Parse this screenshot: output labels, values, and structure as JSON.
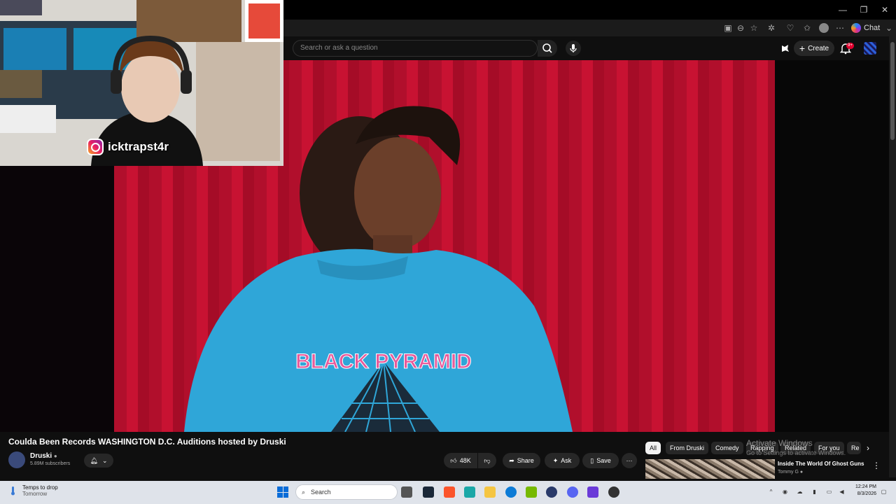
{
  "browser": {
    "window_buttons": [
      "—",
      "❐",
      "✕"
    ],
    "chat_label": "Chat"
  },
  "youtube": {
    "search": {
      "placeholder": "Search or ask a question"
    },
    "create_label": "Create",
    "notification_count": "9+"
  },
  "webcam": {
    "instagram_handle": "icktrapst4r"
  },
  "video": {
    "title": "Coulda Been Records WASHINGTON D.C. Auditions hosted by Druski",
    "channel": "Druski",
    "subscribers": "5.89M subscribers",
    "shirt_text": "BLACK PYRAMID",
    "actions": {
      "likes": "48K",
      "share": "Share",
      "ask": "Ask",
      "save": "Save"
    }
  },
  "related": {
    "chips": [
      "All",
      "From Druski",
      "Comedy",
      "Rapping",
      "Related",
      "For you",
      "Re"
    ],
    "first_item": {
      "title": "Inside The World Of Ghost Guns",
      "channel": "Tommy G"
    }
  },
  "watermark": {
    "title": "Activate Windows",
    "subtitle": "Go to Settings to activate Windows."
  },
  "taskbar": {
    "weather_line1": "Temps to drop",
    "weather_line2": "Tomorrow",
    "search_label": "Search",
    "time": "12:24 PM",
    "date": "8/3/2026"
  },
  "colors": {
    "accent_red": "#e1002d",
    "curtain_red": "#c81232",
    "shirt_blue": "#2fa6d8"
  }
}
